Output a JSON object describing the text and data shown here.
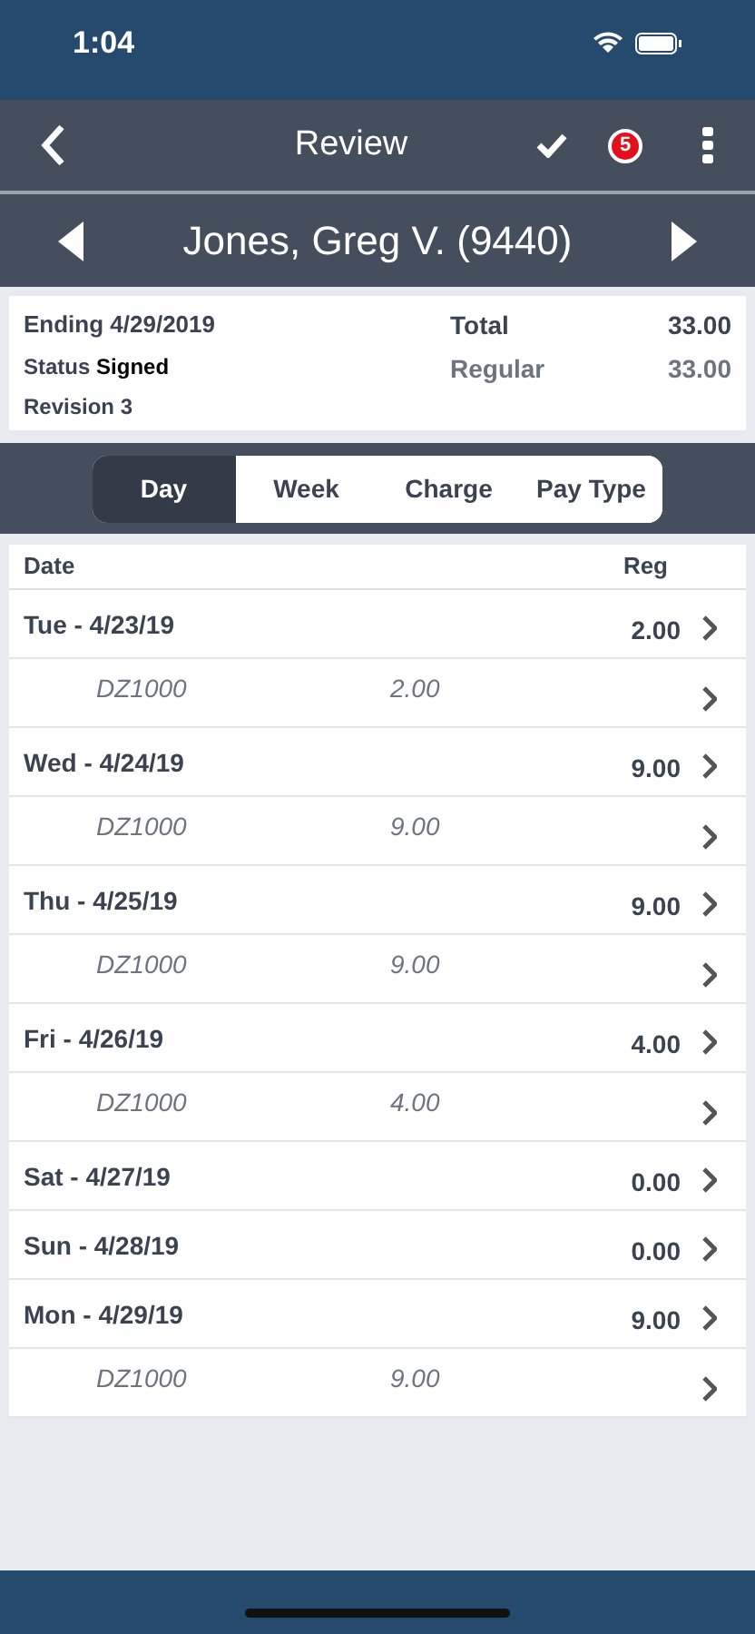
{
  "status_bar": {
    "time": "1:04"
  },
  "nav": {
    "title": "Review",
    "badge": "5"
  },
  "employee": {
    "name": "Jones, Greg V. (9440)"
  },
  "summary": {
    "ending": "Ending 4/29/2019",
    "status_label": "Status",
    "status_value": "Signed",
    "revision": "Revision 3",
    "totals": [
      {
        "label": "Total",
        "value": "33.00",
        "kind": "total"
      },
      {
        "label": "Regular",
        "value": "33.00",
        "kind": "regular"
      }
    ]
  },
  "tabs": [
    {
      "label": "Day",
      "selected": true
    },
    {
      "label": "Week",
      "selected": false
    },
    {
      "label": "Charge",
      "selected": false
    },
    {
      "label": "Pay Type",
      "selected": false
    }
  ],
  "table": {
    "columns": [
      "Date",
      "Reg"
    ],
    "rows": [
      {
        "date": "Tue - 4/23/19",
        "reg": "2.00",
        "children": [
          {
            "charge": "DZ1000",
            "hours": "2.00"
          }
        ]
      },
      {
        "date": "Wed - 4/24/19",
        "reg": "9.00",
        "children": [
          {
            "charge": "DZ1000",
            "hours": "9.00"
          }
        ]
      },
      {
        "date": "Thu - 4/25/19",
        "reg": "9.00",
        "children": [
          {
            "charge": "DZ1000",
            "hours": "9.00"
          }
        ]
      },
      {
        "date": "Fri - 4/26/19",
        "reg": "4.00",
        "children": [
          {
            "charge": "DZ1000",
            "hours": "4.00"
          }
        ]
      },
      {
        "date": "Sat - 4/27/19",
        "reg": "0.00"
      },
      {
        "date": "Sun - 4/28/19",
        "reg": "0.00"
      },
      {
        "date": "Mon - 4/29/19",
        "reg": "9.00",
        "children": [
          {
            "charge": "DZ1000",
            "hours": "9.00"
          }
        ]
      }
    ]
  }
}
